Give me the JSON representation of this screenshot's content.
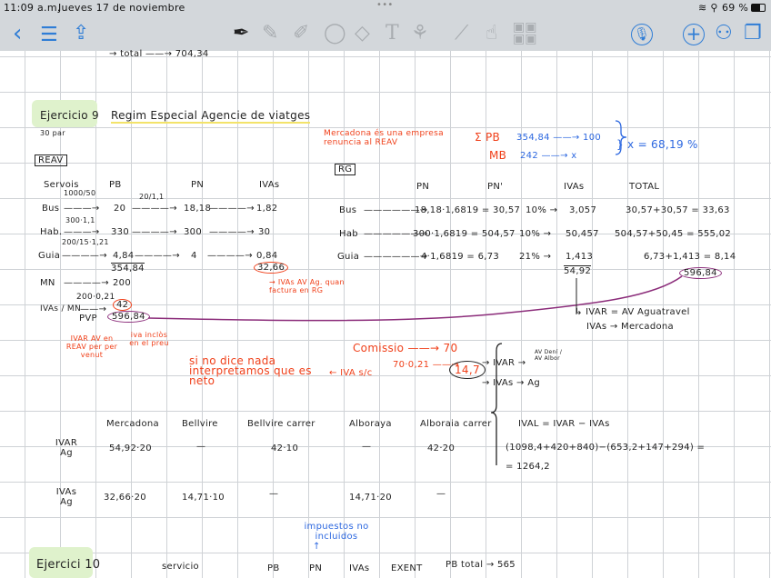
{
  "status": {
    "time": "11:09 a.m.",
    "date": "Jueves 17 de noviembre",
    "battery": "69 %"
  },
  "toolbar": {
    "icons": [
      "back-icon",
      "menu-icon",
      "share-icon",
      "pen-icon",
      "pencil-icon",
      "highlighter-icon",
      "lasso-icon",
      "eraser-icon",
      "text-icon",
      "shapes-icon",
      "ruler-icon",
      "hand-icon",
      "image-icon",
      "microphone-icon",
      "add-page-icon",
      "collaborate-icon",
      "pages-icon"
    ]
  },
  "colors": {
    "accent": "#2f7dd6",
    "red_ink": "#f0401a",
    "blue_ink": "#2d68e0",
    "purple_ink": "#8b2c7a"
  },
  "notes": {
    "top_cut": "→ total ——→ 704,34",
    "ex9_title": "Ejercicio 9",
    "ex9_subtitle": "Regim Especial Agencie de viatges",
    "ex9_pages": "30 par",
    "reav": "REAV",
    "reav_headers": [
      "Servois",
      "PB",
      "PN",
      "IVAs"
    ],
    "reav_rows": [
      {
        "label": "Bus",
        "calc": "1000/50",
        "pb": "20",
        "div": "20/1,1",
        "pn": "18,18",
        "iva": "1,82"
      },
      {
        "label": "Hab.",
        "calc": "300·1,1",
        "pb": "330",
        "pn": "300",
        "iva": "30"
      },
      {
        "label": "Guia",
        "calc": "200/15·1,21",
        "pb": "4,84",
        "pn": "4",
        "iva": "0,84"
      }
    ],
    "pb_total": "354,84",
    "iva_total": "32,66",
    "iva_note": "→ IVAs AV Ag. quan factura en RG",
    "mn_label": "MN",
    "mn_value": "200",
    "mn_calc": "200·0,21",
    "ivas_mn_label": "IVAs / MN",
    "ivas_mn_value": "42",
    "pvp_label": "PVP",
    "pvp_value": "596,84",
    "note_ivar": "IVAR AV en REAV per per venut",
    "note_iva_inclos": "iva inclòs en el preu",
    "mercadona_note": "Mercadona és una empresa renuncia al REAV",
    "sum_pb": "Σ PB",
    "sum_mb": "MB",
    "pb_val": "354,84 ——→ 100",
    "mb_val": "242 ——→ x",
    "pct": "} x = 68,19 %",
    "rg": "RG",
    "rg_headers": [
      "PN",
      "PN'",
      "IVAs",
      "TOTAL"
    ],
    "rg_rows": [
      {
        "label": "Bus",
        "pn": "18,18·1,6819 = 30,57",
        "rate": "10% →",
        "iva": "3,057",
        "total": "30,57+30,57 = 33,63"
      },
      {
        "label": "Hab",
        "pn": "300·1,6819 = 504,57",
        "rate": "10% →",
        "iva": "50,457",
        "total": "504,57+50,45 = 555,02"
      },
      {
        "label": "Guia",
        "pn": "4·1,6819 = 6,73",
        "rate": "21% →",
        "iva": "1,413",
        "total": "6,73+1,413 = 8,14"
      }
    ],
    "rg_iva_total": "54,92",
    "rg_total": "596,84",
    "ivar_line": "↳ IVAR = AV Aguatravel",
    "ivas_line": "IVAs → Mercadona",
    "comissio": "Comissio ——→ 70",
    "neto_note": "si no dice nada interpretamos que es neto",
    "iva_sc": "← IVA s/c",
    "iva_calc": "70·0,21 ——→",
    "iva_result": "14,7",
    "ivar_branch": "→ IVAR →",
    "ivar_dest": "AV Dení / AV Albor",
    "ivas_branch": "→ IVAs → Ag",
    "table_headers": [
      "Mercadona",
      "Bellvire",
      "Bellvire carrer",
      "Alboraya",
      "Alboraia carrer"
    ],
    "table_rows": [
      {
        "label": "IVAR Ag",
        "values": [
          "54,92·20",
          "—",
          "42·10",
          "—",
          "42·20"
        ]
      },
      {
        "label": "IVAs Ag",
        "values": [
          "32,66·20",
          "14,71·10",
          "—",
          "14,71·20",
          "—"
        ]
      }
    ],
    "ival_formula": "IVAL = IVAR − IVAs",
    "ival_calc": "(1098,4+420+840)−(653,2+147+294) =",
    "ival_result": "= 1264,2",
    "impuestos_note": "impuestos no incluidos",
    "ex10_title": "Ejercici 10",
    "ex10_headers": [
      "servicio",
      "PB",
      "PN",
      "IVAs",
      "EXENT"
    ],
    "ex10_total": "PB total → 565"
  }
}
